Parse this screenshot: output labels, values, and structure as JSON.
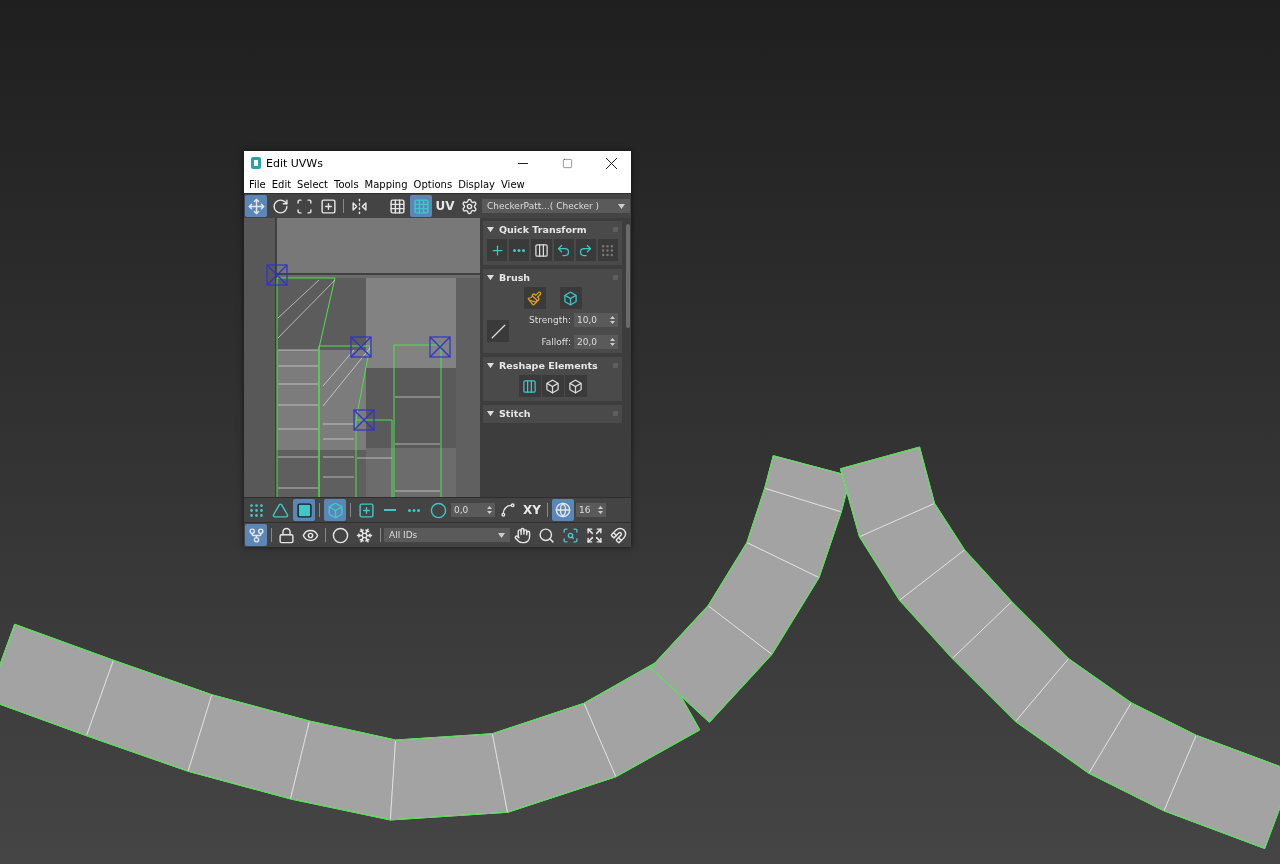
{
  "window": {
    "title": "Edit UVWs"
  },
  "menu": [
    "File",
    "Edit",
    "Select",
    "Tools",
    "Mapping",
    "Options",
    "Display",
    "View"
  ],
  "toolbar": [
    {
      "kind": "move",
      "selected": true
    },
    {
      "kind": "rotate",
      "selected": false
    },
    {
      "kind": "freeform",
      "selected": false
    },
    {
      "kind": "scale",
      "selected": false
    },
    {
      "kind": "mirror",
      "selected": false
    },
    {
      "kind": "checker",
      "selected": false
    },
    {
      "kind": "checker-pattern",
      "selected": true
    },
    {
      "kind": "text",
      "label": "UV",
      "selected": false
    },
    {
      "kind": "settings",
      "selected": false
    }
  ],
  "texture_dropdown": {
    "value": "CheckerPatt...( Checker )"
  },
  "rollouts": [
    {
      "kind": "quick-transform",
      "title": "Quick Transform",
      "expanded": true
    },
    {
      "kind": "brush",
      "title": "Brush",
      "expanded": true,
      "fields": [
        {
          "label": "Strength:",
          "value": "10,0"
        },
        {
          "label": "Falloff:",
          "value": "20,0"
        }
      ]
    },
    {
      "kind": "reshape",
      "title": "Reshape Elements",
      "expanded": true
    },
    {
      "kind": "stitch",
      "title": "Stitch",
      "expanded": true
    }
  ],
  "selection_bar": [
    {
      "kind": "vertex",
      "selected": false
    },
    {
      "kind": "edge",
      "selected": false
    },
    {
      "kind": "face",
      "selected": true
    },
    {
      "kind": "element",
      "selected": true
    },
    {
      "kind": "grow",
      "selected": false
    },
    {
      "kind": "shrink",
      "selected": false
    },
    {
      "kind": "loop",
      "selected": false
    },
    {
      "kind": "soft",
      "selected": false
    }
  ],
  "soft_value": "0,0",
  "axis_label": "XY",
  "grid_snap": {
    "selected": true,
    "value": "16"
  },
  "bottom_bar": [
    {
      "kind": "pick",
      "selected": true
    },
    {
      "kind": "lock",
      "selected": false
    },
    {
      "kind": "eye",
      "selected": false
    },
    {
      "kind": "hide",
      "selected": false
    },
    {
      "kind": "freeze",
      "selected": false
    }
  ],
  "id_filter": {
    "value": "All IDs"
  },
  "nav_bar": [
    {
      "kind": "pan"
    },
    {
      "kind": "zoom"
    },
    {
      "kind": "zoom-region"
    },
    {
      "kind": "zoom-extents"
    },
    {
      "kind": "magnet"
    }
  ]
}
